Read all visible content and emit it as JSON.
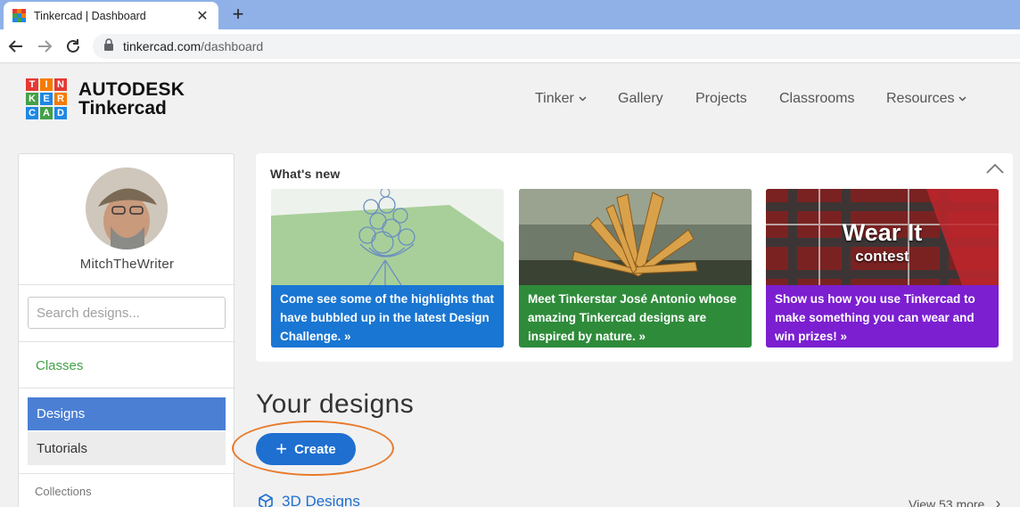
{
  "browser": {
    "tab_title": "Tinkercad | Dashboard",
    "close_glyph": "✕",
    "new_tab_glyph": "+",
    "url_host": "tinkercad.com",
    "url_path": "/dashboard"
  },
  "header": {
    "logo_letters": [
      "T",
      "I",
      "N",
      "K",
      "E",
      "R",
      "C",
      "A",
      "D"
    ],
    "logo_colors": [
      "#e53935",
      "#f57c00",
      "#e53935",
      "#43a047",
      "#1e88e5",
      "#f57c00",
      "#1e88e5",
      "#43a047",
      "#1e88e5"
    ],
    "brand_top": "AUTODESK",
    "brand_bottom": "Tinkercad",
    "nav": {
      "tinker": "Tinker",
      "gallery": "Gallery",
      "projects": "Projects",
      "classrooms": "Classrooms",
      "resources": "Resources"
    },
    "caret": "⌄"
  },
  "sidebar": {
    "username": "MitchTheWriter",
    "search_placeholder": "Search designs...",
    "classes": "Classes",
    "designs": "Designs",
    "tutorials": "Tutorials",
    "collections": "Collections"
  },
  "whats_new": {
    "title": "What's new",
    "cards": [
      {
        "text": "Come see some of the highlights that have bubbled up in the latest Design Challenge. »",
        "color": "#1976d2"
      },
      {
        "text": "Meet Tinkerstar José Antonio whose amazing Tinkercad designs are inspired by nature. »",
        "color": "#2e8b3a"
      },
      {
        "text": "Show us how you use Tinkercad to make something you can wear and win prizes! »",
        "color": "#7b1fd0",
        "img_title": "Wear It",
        "img_subtitle": "contest"
      }
    ]
  },
  "main": {
    "heading": "Your designs",
    "create_plus": "+",
    "create_label": "Create",
    "designs_3d": "3D Designs",
    "view_more": "View 53 more",
    "chevron": "›"
  },
  "colors": {
    "accent_blue": "#1e6fd0",
    "sidebar_active": "#4a7fd4",
    "annotation": "#e87a2a"
  }
}
